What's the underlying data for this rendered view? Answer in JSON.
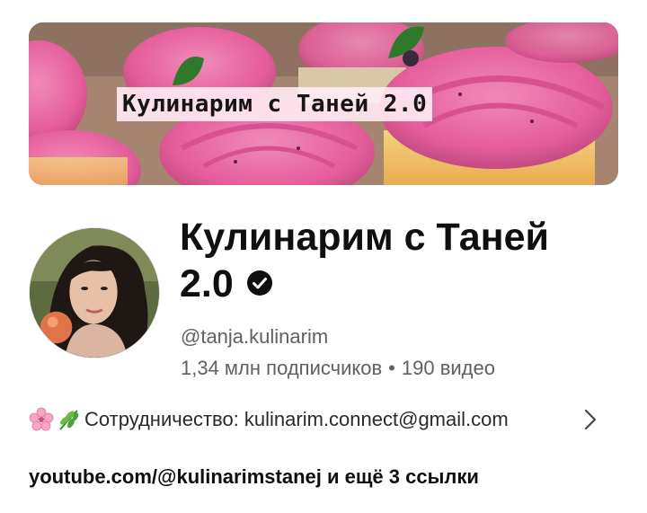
{
  "banner": {
    "title": "Кулинарим с Таней 2.0"
  },
  "channel": {
    "name": "Кулинарим с Таней 2.0",
    "handle": "@tanja.kulinarim",
    "subscribers": "1,34 млн подписчиков",
    "separator": "•",
    "videos": "190 видео"
  },
  "description": {
    "text": "Сотрудничество: kulinarim.connect@gmail.com",
    "icons": [
      "cherry-blossom-icon",
      "herb-icon"
    ]
  },
  "links": {
    "primary": "youtube.com/@kulinarimstanej",
    "more": "и ещё 3 ссылки"
  },
  "colors": {
    "text_primary": "#0f0f0f",
    "text_secondary": "#606060",
    "frosting_pink": "#e65f9c"
  }
}
